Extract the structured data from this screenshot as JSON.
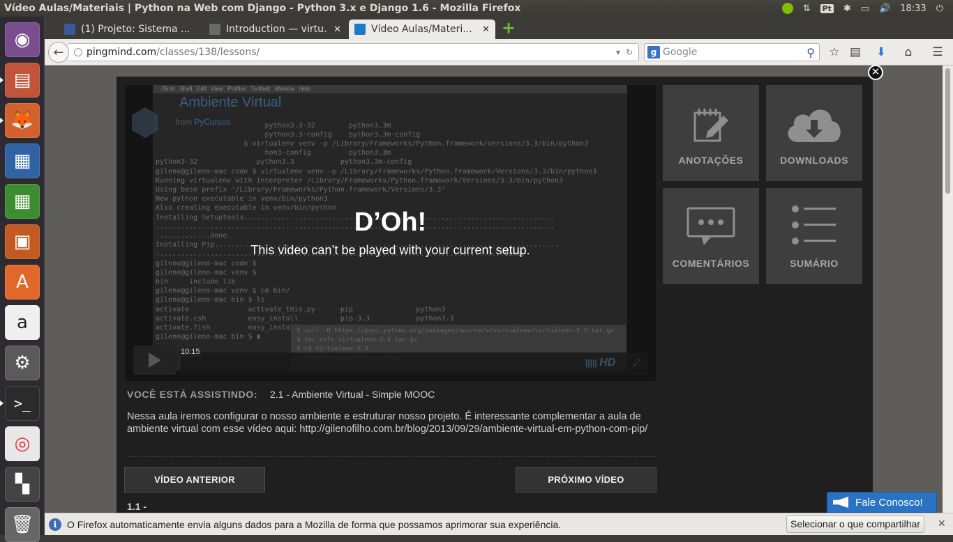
{
  "window_title": "Vídeo Aulas/Materiais | Python na Web com Django - Python 3.x e Django 1.6 - Mozilla Firefox",
  "panel": {
    "keyboard": "Pt",
    "clock": "18:33"
  },
  "tabs": [
    {
      "label": "(1) Projeto: Sistema ...",
      "favicon_color": "#3b5998",
      "active": false
    },
    {
      "label": "Introduction — virtu...",
      "favicon_color": "#6a6a6a",
      "active": false
    },
    {
      "label": "Vídeo Aulas/Materi...",
      "favicon_color": "#1d7ac4",
      "active": true
    }
  ],
  "url": {
    "host": "pingmind.com",
    "path": "/classes/138/lessons/"
  },
  "search": {
    "placeholder": "Google"
  },
  "player": {
    "error_title": "D’Oh!",
    "error_message": "This video can’t be played with your current setup.",
    "timecode": "10:15",
    "brand_title": "Ambiente Virtual",
    "brand_from": "from",
    "brand_name": "PyCursos",
    "hd_label": "HD",
    "terminal_menu": " iTerm   Shell   Edit   View   Profiles   Toolbelt   Window   Help",
    "terminal_lines": [
      "                          python3.3-32        python3.3m",
      "                          python3.3-config    python3.3m-config",
      "                     $ virtualenv venv -p /Library/Frameworks/Python.framework/Versions/3.3/bin/python3",
      "                          hon3-config         python3.3m",
      "python3-32              python3.3           python3.3m-config",
      "gileno@gileno-mac code $ virtualenv venv -p /Library/Frameworks/Python.framework/Versions/3.3/bin/python3",
      "Running virtualenv with interpreter /Library/Frameworks/Python.framework/Versions/3.3/bin/python3",
      "Using base prefix '/Library/Frameworks/Python.framework/Versions/3.3'",
      "New python executable in venv/bin/python3",
      "Also creating executable in venv/bin/python",
      "Installing Setuptools..........................................................................",
      "...............................................................................................",
      ".............done.",
      "Installing Pip..................................................................................",
      "...................................................................................done.",
      "gileno@gileno-mac code $",
      "gileno@gileno-mac venv $",
      "bin     include lib",
      "gileno@gileno-mac venv $ cd bin/",
      "gileno@gileno-mac bin $ ls",
      "activate              activate_this.py      pip               python3",
      "activate.csh          easy_install          pip-3.3           python3.3",
      "activate.fish         easy_install-3.3      python",
      "gileno@gileno-mac bin $ ▮"
    ],
    "browser_lines": [
      "$ curl -O https://pypi.python.org/packages/source/v/virtualenv/virtualenv-X.X.tar.gz",
      "$ tar xvfz virtualenv-X.X.tar.gz",
      "$ cd virtualenv-X.X",
      "$ python virtualenv.py myVE"
    ]
  },
  "side_tiles": [
    {
      "label": "ANOTAÇÕES",
      "icon": "edit-icon"
    },
    {
      "label": "DOWNLOADS",
      "icon": "cloud-download-icon"
    },
    {
      "label": "COMENTÁRIOS",
      "icon": "comment-icon"
    },
    {
      "label": "SUMÁRIO",
      "icon": "list-icon"
    }
  ],
  "lesson": {
    "watching_label": "VOCÊ ESTÁ ASSISTINDO:",
    "watching_title": "2.1 - Ambiente Virtual - Simple MOOC",
    "description": "Nessa aula iremos configurar o nosso ambiente e estruturar nosso projeto. É interessante complementar a aula de ambiente virtual com esse vídeo aqui: http://gilenofilho.com.br/blog/2013/09/29/ambiente-virtual-em-python-com-pip/",
    "prev_label": "VÍDEO ANTERIOR",
    "next_label": "PRÓXIMO VÍDEO",
    "next_item": "1.1 -"
  },
  "fale_conosco": "Fale Conosco!",
  "notification": {
    "text": "O Firefox automaticamente envia alguns dados para a Mozilla de forma que possamos aprimorar sua experiência.",
    "share_button": "Selecionar o que compartilhar",
    "close": "✕"
  },
  "colors": {
    "modal_bg": "#1f1f1f",
    "tile_bg": "#3e3e3e",
    "fale_blue": "#2a73c2",
    "launcher_bg": "#2d2a31"
  }
}
